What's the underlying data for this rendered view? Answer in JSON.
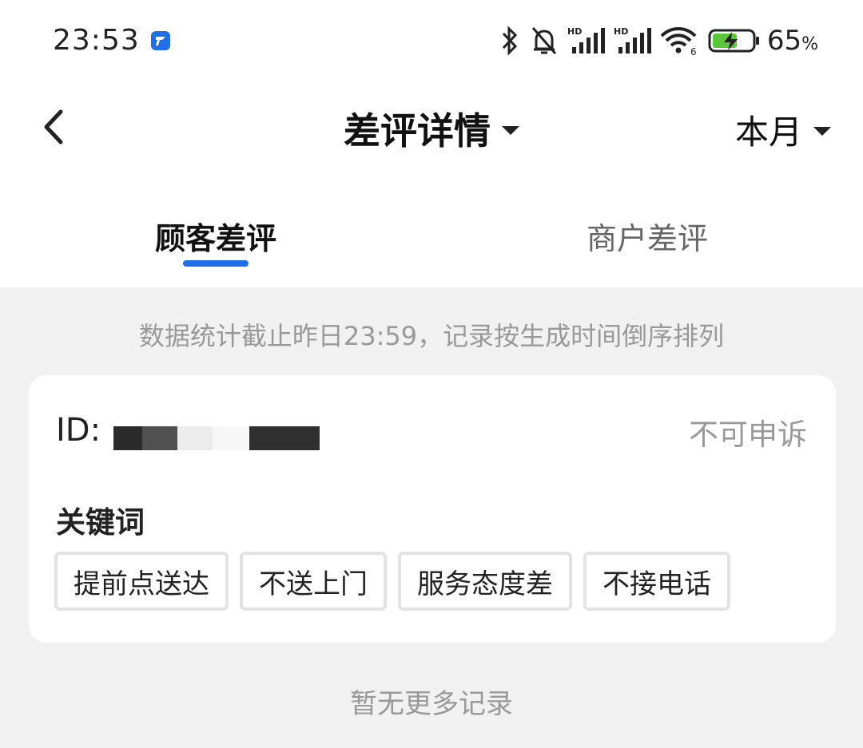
{
  "status_bar": {
    "time": "23:53",
    "battery_percent": "65",
    "battery_unit": "%",
    "icons": [
      "app-notification-icon",
      "bluetooth-icon",
      "mute-bell-icon",
      "hd-signal-icon",
      "hd-signal-icon",
      "wifi-6-icon",
      "battery-charging-icon"
    ]
  },
  "nav": {
    "title": "差评详情",
    "period": "本月"
  },
  "tabs": [
    {
      "label": "顾客差评",
      "active": true
    },
    {
      "label": "商户差评",
      "active": false
    }
  ],
  "colors": {
    "accent": "#1f6fe5",
    "page_background": "#f1f1f1",
    "muted_text": "#999999"
  },
  "notice": "数据统计截止昨日23:59，记录按生成时间倒序排列",
  "review": {
    "id_label": "ID:",
    "appeal_status": "不可申诉",
    "keywords_label": "关键词",
    "keywords": [
      "提前点送达",
      "不送上门",
      "服务态度差",
      "不接电话"
    ]
  },
  "footer": "暂无更多记录"
}
